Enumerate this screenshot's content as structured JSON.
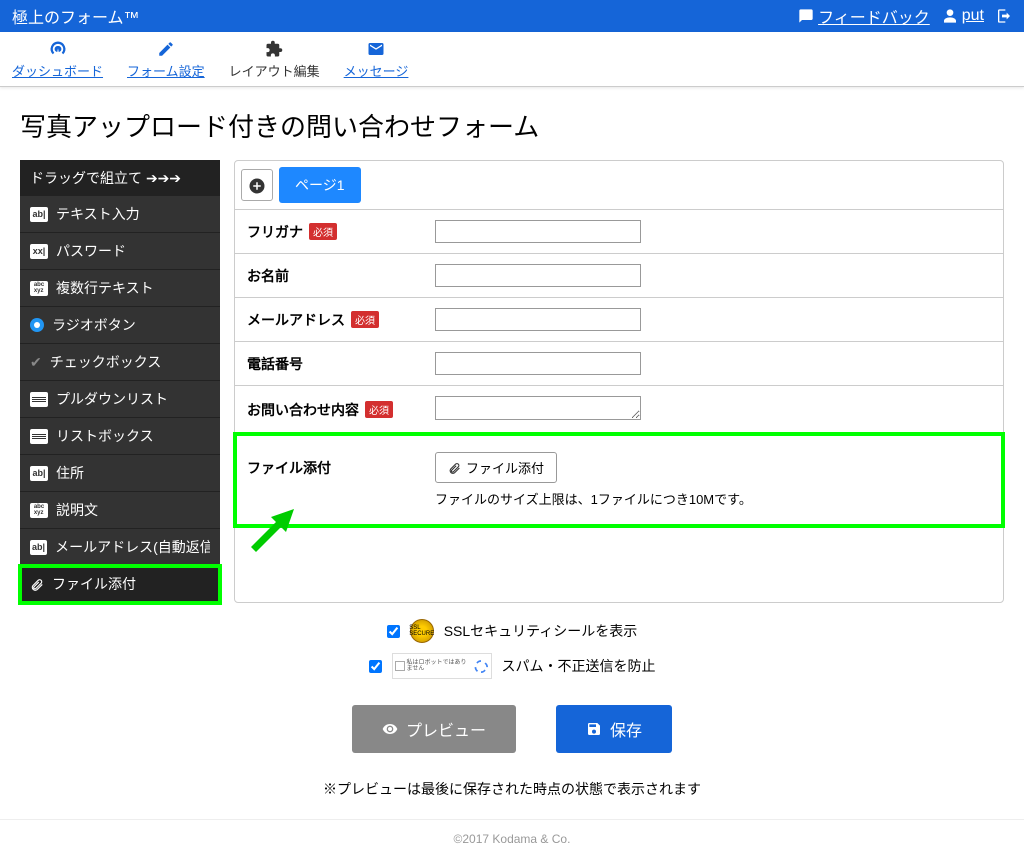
{
  "header": {
    "brand": "極上のフォーム™",
    "feedback": "フィードバック",
    "username": "put"
  },
  "nav": {
    "dashboard": "ダッシュボード",
    "form_settings": "フォーム設定",
    "layout_edit": "レイアウト編集",
    "messages": "メッセージ"
  },
  "page_title": "写真アップロード付きの問い合わせフォーム",
  "sidebar": {
    "header": "ドラッグで組立て",
    "items": [
      {
        "icon": "ab|",
        "label": "テキスト入力"
      },
      {
        "icon": "xx|",
        "label": "パスワード"
      },
      {
        "icon": "abc\nxyz",
        "label": "複数行テキスト"
      },
      {
        "icon": "radio",
        "label": "ラジオボタン"
      },
      {
        "icon": "check",
        "label": "チェックボックス"
      },
      {
        "icon": "list",
        "label": "プルダウンリスト"
      },
      {
        "icon": "list",
        "label": "リストボックス"
      },
      {
        "icon": "ab|",
        "label": "住所"
      },
      {
        "icon": "abc\nxyz",
        "label": "説明文"
      },
      {
        "icon": "ab|",
        "label": "メールアドレス(自動返信)"
      },
      {
        "icon": "attach",
        "label": "ファイル添付"
      }
    ]
  },
  "tabs": {
    "page1": "ページ1"
  },
  "fields": [
    {
      "label": "フリガナ",
      "required": true,
      "type": "text"
    },
    {
      "label": "お名前",
      "required": false,
      "type": "text"
    },
    {
      "label": "メールアドレス",
      "required": true,
      "type": "text"
    },
    {
      "label": "電話番号",
      "required": false,
      "type": "text"
    },
    {
      "label": "お問い合わせ内容",
      "required": true,
      "type": "textarea"
    },
    {
      "label": "ファイル添付",
      "required": false,
      "type": "file",
      "button": "ファイル添付",
      "help": "ファイルのサイズ上限は、1ファイルにつき10Mです。"
    }
  ],
  "required_text": "必須",
  "options": {
    "ssl": "SSLセキュリティシールを表示",
    "spam": "スパム・不正送信を防止",
    "captcha_text": "私はロボットではありません"
  },
  "actions": {
    "preview": "プレビュー",
    "save": "保存"
  },
  "preview_note": "※プレビューは最後に保存された時点の状態で表示されます",
  "footer": "©2017 Kodama & Co."
}
